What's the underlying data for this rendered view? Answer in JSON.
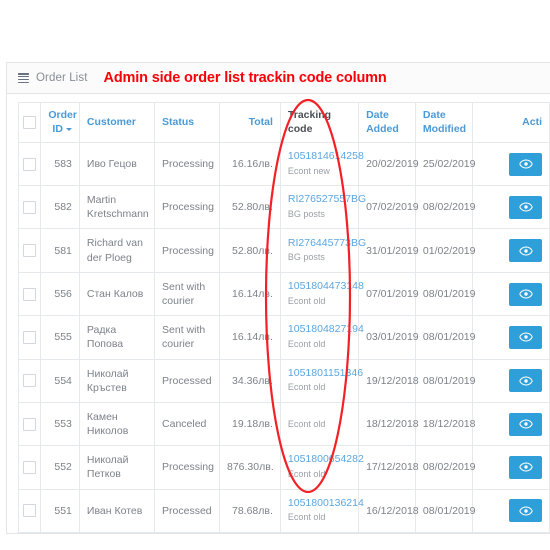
{
  "panel": {
    "icon": "list-icon",
    "title": "Order List",
    "annotation": "Admin side order list trackin code column"
  },
  "colors": {
    "annotation_red": "#fb0007",
    "header_link_blue": "#4b9ad6",
    "button_blue": "#2f9fd9",
    "track_link_blue": "#5ba6e0",
    "body_text": "#7c828a"
  },
  "table": {
    "headers": {
      "select_all": "",
      "order_id": "Order ID",
      "customer": "Customer",
      "status": "Status",
      "total": "Total",
      "tracking_code": "Tracking code",
      "date_added": "Date Added",
      "date_modified": "Date Modified",
      "action": "Acti"
    },
    "rows": [
      {
        "order_id": "583",
        "customer": "Иво Гецов",
        "status": "Processing",
        "total": "16.16лв.",
        "tracking_code": "1051814614258",
        "courier": "Econt new",
        "date_added": "20/02/2019",
        "date_modified": "25/02/2019",
        "action": "view"
      },
      {
        "order_id": "582",
        "customer": "Martin Kretschmann",
        "status": "Processing",
        "total": "52.80лв.",
        "tracking_code": "RI276527557BG",
        "courier": "BG posts",
        "date_added": "07/02/2019",
        "date_modified": "08/02/2019",
        "action": "view"
      },
      {
        "order_id": "581",
        "customer": "Richard van der Ploeg",
        "status": "Processing",
        "total": "52.80лв.",
        "tracking_code": "RI276445773BG",
        "courier": "BG posts",
        "date_added": "31/01/2019",
        "date_modified": "01/02/2019",
        "action": "view"
      },
      {
        "order_id": "556",
        "customer": "Стан Калов",
        "status": "Sent with courier",
        "total": "16.14лв.",
        "tracking_code": "1051804473148",
        "courier": "Econt old",
        "date_added": "07/01/2019",
        "date_modified": "08/01/2019",
        "action": "view"
      },
      {
        "order_id": "555",
        "customer": "Радка Попова",
        "status": "Sent with courier",
        "total": "16.14лв.",
        "tracking_code": "1051804827194",
        "courier": "Econt old",
        "date_added": "03/01/2019",
        "date_modified": "08/01/2019",
        "action": "view"
      },
      {
        "order_id": "554",
        "customer": "Николай Кръстев",
        "status": "Processed",
        "total": "34.36лв.",
        "tracking_code": "1051801151346",
        "courier": "Econt old",
        "date_added": "19/12/2018",
        "date_modified": "08/01/2019",
        "action": "view"
      },
      {
        "order_id": "553",
        "customer": "Камен Николов",
        "status": "Canceled",
        "total": "19.18лв.",
        "tracking_code": "",
        "courier": "Econt old",
        "date_added": "18/12/2018",
        "date_modified": "18/12/2018",
        "action": "view"
      },
      {
        "order_id": "552",
        "customer": "Николай Петков",
        "status": "Processing",
        "total": "876.30лв.",
        "tracking_code": "1051800654282",
        "courier": "Econt old",
        "date_added": "17/12/2018",
        "date_modified": "08/02/2019",
        "action": "view"
      },
      {
        "order_id": "551",
        "customer": "Иван Котев",
        "status": "Processed",
        "total": "78.68лв.",
        "tracking_code": "1051800136214",
        "courier": "Econt old",
        "date_added": "16/12/2018",
        "date_modified": "08/01/2019",
        "action": "view"
      }
    ]
  }
}
